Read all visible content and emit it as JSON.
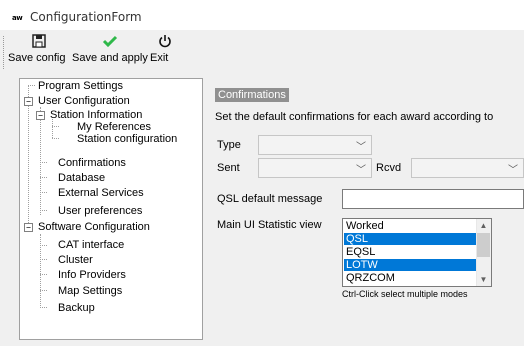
{
  "window": {
    "title": "ConfigurationForm",
    "app_icon_text": "aw"
  },
  "toolbar": {
    "save_config": "Save config",
    "save_and_apply": "Save and apply",
    "exit": "Exit"
  },
  "tree": {
    "program_settings": "Program Settings",
    "user_configuration": "User Configuration",
    "station_information": "Station Information",
    "my_references": "My References",
    "station_configuration": "Station configuration",
    "confirmations": "Confirmations",
    "database": "Database",
    "external_services": "External Services",
    "user_preferences": "User preferences",
    "software_configuration": "Software Configuration",
    "cat_interface": "CAT interface",
    "cluster": "Cluster",
    "info_providers": "Info Providers",
    "map_settings": "Map Settings",
    "backup": "Backup"
  },
  "panel": {
    "header": "Confirmations",
    "description": "Set the default confirmations for each award according to",
    "type_label": "Type",
    "sent_label": "Sent",
    "rcvd_label": "Rcvd",
    "qsl_default_message_label": "QSL default message",
    "main_ui_statistic_label": "Main UI Statistic view",
    "statistic_options": [
      "Worked",
      "QSL",
      "EQSL",
      "LOTW",
      "QRZCOM"
    ],
    "selected_options": [
      "QSL",
      "LOTW"
    ],
    "hint": "Ctrl-Click select multiple modes"
  },
  "colors": {
    "selection": "#0078d7",
    "section_header": "#909090"
  }
}
